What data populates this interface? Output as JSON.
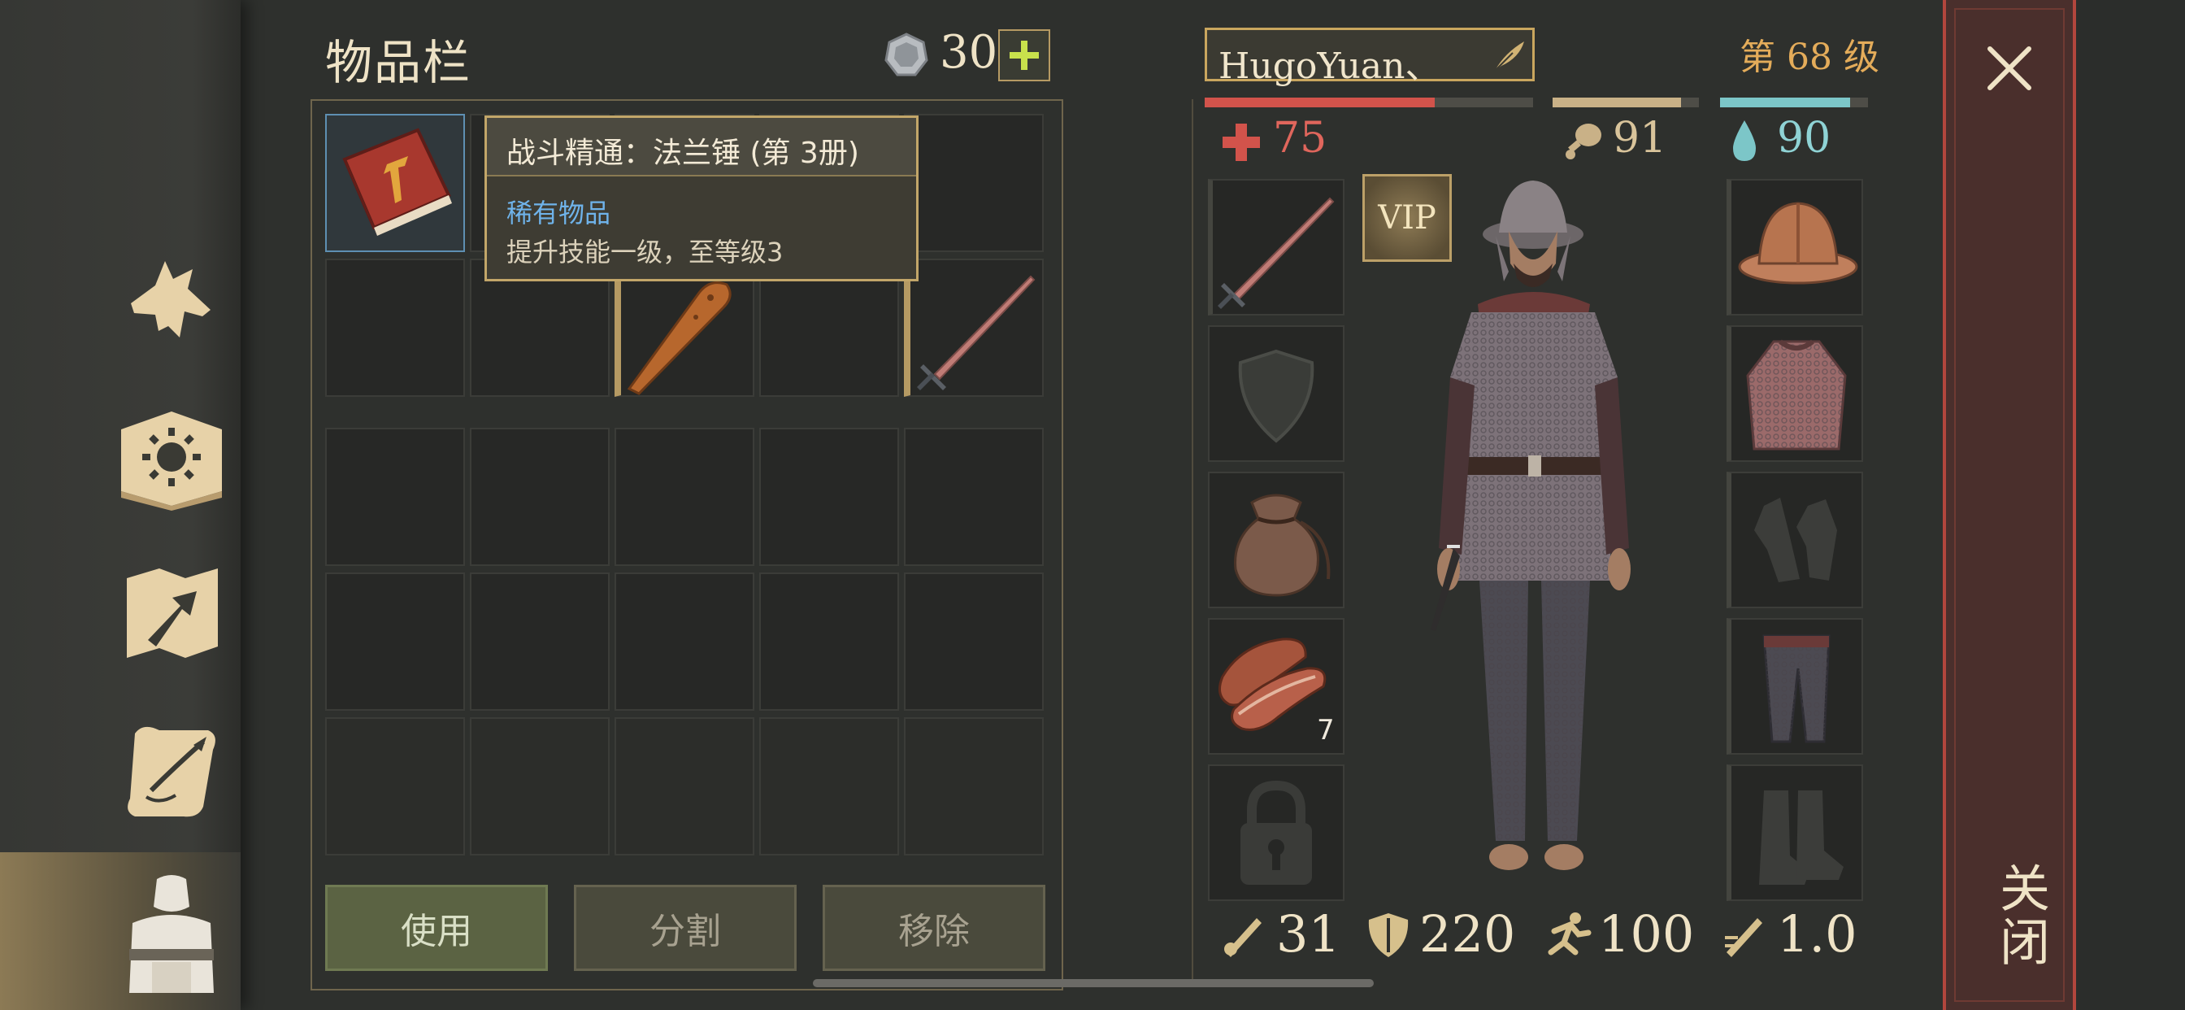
{
  "side_nav": {
    "items": [
      {
        "icon": "wolf-icon"
      },
      {
        "icon": "sun-book-icon"
      },
      {
        "icon": "crafting-map-icon"
      },
      {
        "icon": "scroll-quest-icon"
      },
      {
        "icon": "character-icon",
        "active": true
      }
    ]
  },
  "inventory": {
    "title": "物品栏",
    "coins": "30",
    "add_label": "+",
    "tooltip": {
      "title": "战斗精通：法兰锤 (第 3册)",
      "rarity": "稀有物品",
      "description": "提升技能一级，至等级3"
    },
    "actions": {
      "use": "使用",
      "split": "分割",
      "remove": "移除"
    }
  },
  "character": {
    "name": "HugoYuan、",
    "level": "第 68 级",
    "health": "75",
    "food": "91",
    "water": "90",
    "bars": {
      "health": 0.7,
      "food": 0.88,
      "water": 0.88
    },
    "vip": "VIP",
    "food_stack": "7",
    "stats": {
      "attack": "31",
      "armor": "220",
      "speed": "100",
      "attack_speed": "1.0"
    }
  },
  "close_label": "关闭",
  "colors": {
    "health": "#d2534b",
    "food": "#c9b187",
    "water": "#7cc6c8",
    "accent": "#c9a65e",
    "level": "#e4ac5a"
  }
}
